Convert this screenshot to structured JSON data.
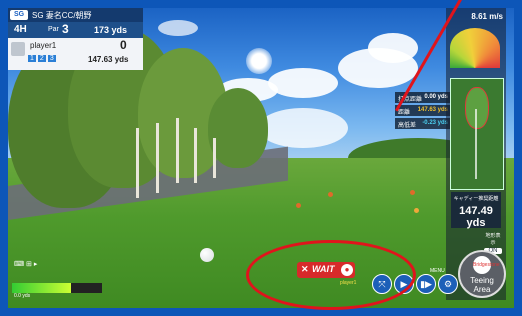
{
  "hud": {
    "logo": "SG",
    "course": "SG 妻名CC/朝野",
    "hole": "4H",
    "par_label": "Par",
    "par_value": "3",
    "hole_distance": "173 yds",
    "player_name": "player1",
    "player_score": "0",
    "shots": [
      "1",
      "2",
      "3"
    ],
    "player_distance": "147.63 yds"
  },
  "wind": "8.61 m/s",
  "info_boxes": [
    {
      "k": "打点距離",
      "v": "0.00 yds"
    },
    {
      "k": "距離",
      "v": "147.63 yds"
    },
    {
      "k": "高低差",
      "v": "-0.23 yds"
    }
  ],
  "caddie": {
    "label": "キャディー推奨距離",
    "value": "147.49 yds"
  },
  "slope": {
    "label": "地形表示",
    "state": "ON"
  },
  "power": {
    "level": 0.65,
    "text": "0.0 yds"
  },
  "bottom_left_icons": "⌨  ⊞ ▸",
  "wait_button": {
    "x": "✕",
    "label": "WAIT",
    "dot": "●"
  },
  "wait_sub": "player1",
  "controls": [
    {
      "icon": "⤧",
      "name": "camera-icon"
    },
    {
      "icon": "▶",
      "name": "replay-icon"
    },
    {
      "icon": "▮▶",
      "name": "skip-icon"
    },
    {
      "icon": "⚙",
      "name": "settings-icon"
    }
  ],
  "control_label": "MENU",
  "teeing": {
    "ball_text": "Bridgestone",
    "label1": "Teeing",
    "label2": "Area"
  },
  "colors": {
    "frame": "#0d56b8",
    "annotation": "#e0141c",
    "wait": "#d72a2a"
  }
}
